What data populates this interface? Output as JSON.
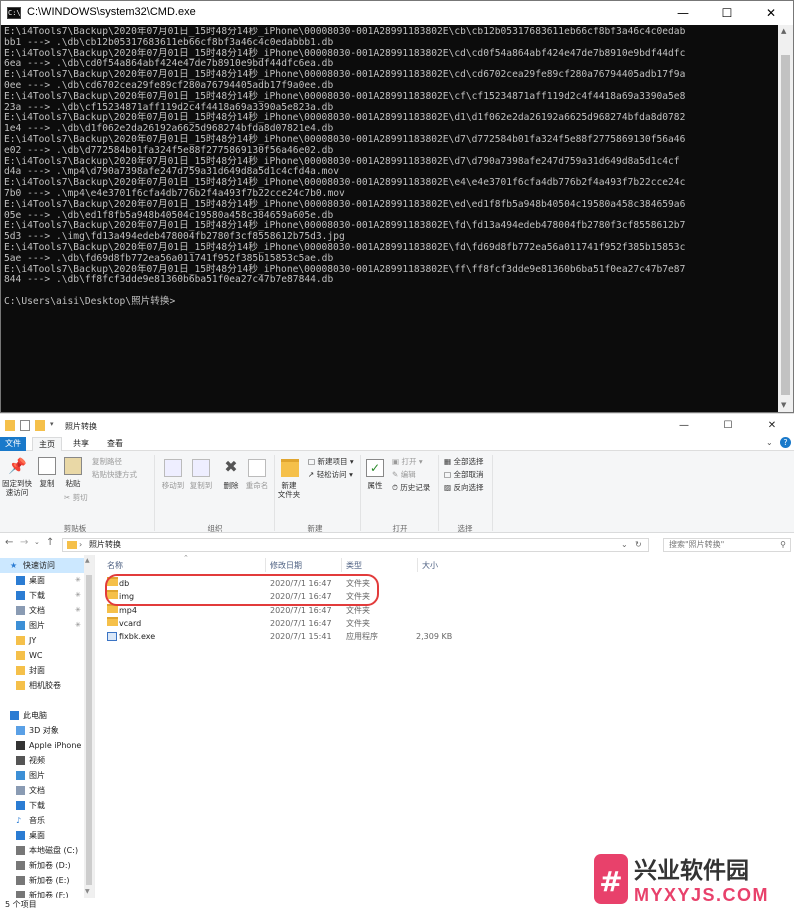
{
  "cmd": {
    "title": "C:\\WINDOWS\\system32\\CMD.exe",
    "lines": [
      "E:\\i4Tools7\\Backup\\2020年07月01日_15时48分14秒_iPhone\\00008030-001A28991183802E\\cb\\cb12b05317683611eb66cf8bf3a46c4c0edab",
      "bb1 ---> .\\db\\cb12b05317683611eb66cf8bf3a46c4c0edabbb1.db",
      "E:\\i4Tools7\\Backup\\2020年07月01日_15时48分14秒_iPhone\\00008030-001A28991183802E\\cd\\cd0f54a864abf424e47de7b8910e9bdf44dfc",
      "6ea ---> .\\db\\cd0f54a864abf424e47de7b8910e9bdf44dfc6ea.db",
      "E:\\i4Tools7\\Backup\\2020年07月01日_15时48分14秒_iPhone\\00008030-001A28991183802E\\cd\\cd6702cea29fe89cf280a76794405adb17f9a",
      "0ee ---> .\\db\\cd6702cea29fe89cf280a76794405adb17f9a0ee.db",
      "E:\\i4Tools7\\Backup\\2020年07月01日_15时48分14秒_iPhone\\00008030-001A28991183802E\\cf\\cf15234871aff119d2c4f4418a69a3390a5e8",
      "23a ---> .\\db\\cf15234871aff119d2c4f4418a69a3390a5e823a.db",
      "E:\\i4Tools7\\Backup\\2020年07月01日_15时48分14秒_iPhone\\00008030-001A28991183802E\\d1\\d1f062e2da26192a6625d968274bfda8d0782",
      "1e4 ---> .\\db\\d1f062e2da26192a6625d968274bfda8d07821e4.db",
      "E:\\i4Tools7\\Backup\\2020年07月01日_15时48分14秒_iPhone\\00008030-001A28991183802E\\d7\\d772584b01fa324f5e88f2775869130f56a46",
      "e02 ---> .\\db\\d772584b01fa324f5e88f2775869130f56a46e02.db",
      "E:\\i4Tools7\\Backup\\2020年07月01日_15时48分14秒_iPhone\\00008030-001A28991183802E\\d7\\d790a7398afe247d759a31d649d8a5d1c4cf",
      "d4a ---> .\\mp4\\d790a7398afe247d759a31d649d8a5d1c4cfd4a.mov",
      "E:\\i4Tools7\\Backup\\2020年07月01日_15时48分14秒_iPhone\\00008030-001A28991183802E\\e4\\e4e3701f6cfa4db776b2f4a493f7b22cce24c",
      "7b0 ---> .\\mp4\\e4e3701f6cfa4db776b2f4a493f7b22cce24c7b0.mov",
      "E:\\i4Tools7\\Backup\\2020年07月01日_15时48分14秒_iPhone\\00008030-001A28991183802E\\ed\\ed1f8fb5a948b40504c19580a458c384659a6",
      "05e ---> .\\db\\ed1f8fb5a948b40504c19580a458c384659a605e.db",
      "E:\\i4Tools7\\Backup\\2020年07月01日_15时48分14秒_iPhone\\00008030-001A28991183802E\\fd\\fd13a494edeb478004fb2780f3cf8558612b7",
      "5d3 ---> .\\img\\fd13a494edeb478004fb2780f3cf8558612b75d3.jpg",
      "E:\\i4Tools7\\Backup\\2020年07月01日_15时48分14秒_iPhone\\00008030-001A28991183802E\\fd\\fd69d8fb772ea56a011741f952f385b15853c",
      "5ae ---> .\\db\\fd69d8fb772ea56a011741f952f385b15853c5ae.db",
      "E:\\i4Tools7\\Backup\\2020年07月01日_15时48分14秒_iPhone\\00008030-001A28991183802E\\ff\\ff8fcf3dde9e81360b6ba51f0ea27c47b7e87",
      "844 ---> .\\db\\ff8fcf3dde9e81360b6ba51f0ea27c47b7e87844.db",
      "",
      "C:\\Users\\aisi\\Desktop\\照片转换>"
    ]
  },
  "explorer": {
    "title": "照片转换",
    "tabs": [
      "文件",
      "主页",
      "共享",
      "查看"
    ],
    "ribbon": {
      "pin_label": "固定到快\n速访问",
      "copy": "复制",
      "paste": "粘贴",
      "copy_path": "复制路径",
      "paste_shortcut": "粘贴快捷方式",
      "cut": "剪切",
      "group_clipboard": "剪贴板",
      "move_to": "移动到",
      "copy_to": "复制到",
      "delete": "删除",
      "rename": "重命名",
      "group_organize": "组织",
      "new_folder": "新建\n文件夹",
      "new_item": "新建项目",
      "easy_access": "轻松访问",
      "group_new": "新建",
      "properties": "属性",
      "open": "打开",
      "edit": "编辑",
      "history": "历史记录",
      "group_open": "打开",
      "select_all": "全部选择",
      "select_none": "全部取消",
      "invert": "反向选择",
      "group_select": "选择"
    },
    "address": "照片转换",
    "search_placeholder": "搜索\"照片转换\"",
    "columns": {
      "name": "名称",
      "date": "修改日期",
      "type": "类型",
      "size": "大小"
    },
    "files": [
      {
        "name": "db",
        "date": "2020/7/1 16:47",
        "type": "文件夹",
        "size": ""
      },
      {
        "name": "img",
        "date": "2020/7/1 16:47",
        "type": "文件夹",
        "size": ""
      },
      {
        "name": "mp4",
        "date": "2020/7/1 16:47",
        "type": "文件夹",
        "size": ""
      },
      {
        "name": "vcard",
        "date": "2020/7/1 16:47",
        "type": "文件夹",
        "size": ""
      },
      {
        "name": "fixbk.exe",
        "date": "2020/7/1 15:41",
        "type": "应用程序",
        "size": "2,309 KB"
      }
    ],
    "nav": [
      {
        "label": "快速访问",
        "icon": "star-icon",
        "indent": 0,
        "pin": false
      },
      {
        "label": "桌面",
        "icon": "desktop-icon",
        "indent": 1,
        "pin": true
      },
      {
        "label": "下载",
        "icon": "download-icon",
        "indent": 1,
        "pin": true
      },
      {
        "label": "文档",
        "icon": "document-icon",
        "indent": 1,
        "pin": true
      },
      {
        "label": "图片",
        "icon": "picture-icon",
        "indent": 1,
        "pin": true
      },
      {
        "label": "JY",
        "icon": "folder-icon",
        "indent": 1,
        "pin": false
      },
      {
        "label": "WC",
        "icon": "folder-icon",
        "indent": 1,
        "pin": false
      },
      {
        "label": "封面",
        "icon": "folder-icon",
        "indent": 1,
        "pin": false
      },
      {
        "label": "相机胶卷",
        "icon": "folder-icon",
        "indent": 1,
        "pin": false
      },
      {
        "label": "",
        "icon": "",
        "indent": 0,
        "pin": false
      },
      {
        "label": "此电脑",
        "icon": "computer-icon",
        "indent": 0,
        "pin": false
      },
      {
        "label": "3D 对象",
        "icon": "cube-icon",
        "indent": 1,
        "pin": false
      },
      {
        "label": "Apple iPhone",
        "icon": "phone-icon",
        "indent": 1,
        "pin": false
      },
      {
        "label": "视频",
        "icon": "video-icon",
        "indent": 1,
        "pin": false
      },
      {
        "label": "图片",
        "icon": "picture-icon",
        "indent": 1,
        "pin": false
      },
      {
        "label": "文档",
        "icon": "document-icon",
        "indent": 1,
        "pin": false
      },
      {
        "label": "下载",
        "icon": "download-icon",
        "indent": 1,
        "pin": false
      },
      {
        "label": "音乐",
        "icon": "music-icon",
        "indent": 1,
        "pin": false
      },
      {
        "label": "桌面",
        "icon": "desktop-icon",
        "indent": 1,
        "pin": false
      },
      {
        "label": "本地磁盘 (C:)",
        "icon": "drive-icon",
        "indent": 1,
        "pin": false
      },
      {
        "label": "新加卷 (D:)",
        "icon": "drive-icon",
        "indent": 1,
        "pin": false
      },
      {
        "label": "新加卷 (E:)",
        "icon": "drive-icon",
        "indent": 1,
        "pin": false
      },
      {
        "label": "新加卷 (F:)",
        "icon": "drive-icon",
        "indent": 1,
        "pin": false
      }
    ],
    "status": "5 个项目"
  },
  "watermark": {
    "brand_cn": "兴业软件园",
    "brand_url": "MYXYJS.COM"
  },
  "colors": {
    "cmd_bg": "#0c0c0c",
    "cmd_text": "#c0c0c0",
    "file_tab": "#1979ca",
    "highlight": "#e23b3b",
    "watermark": "#e8416b"
  }
}
